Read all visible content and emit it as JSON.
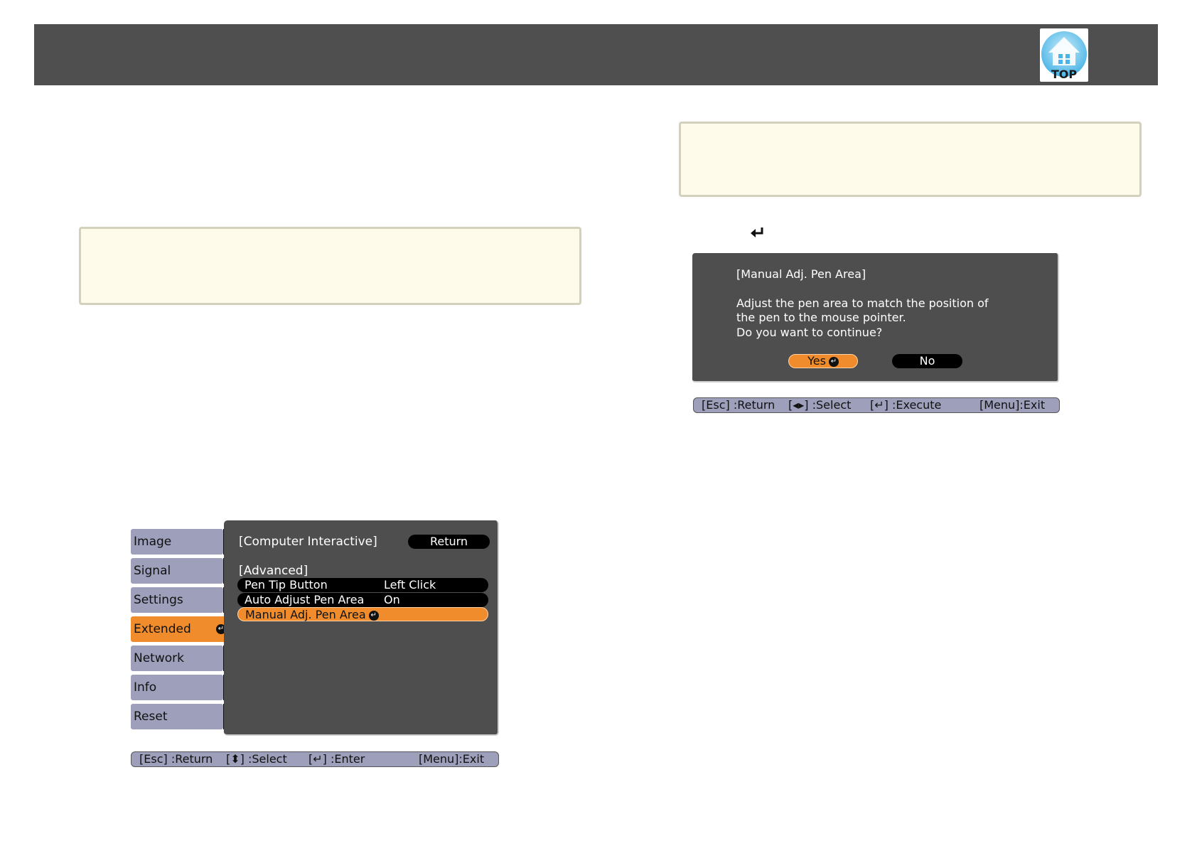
{
  "header": {
    "top_button_label": "TOP"
  },
  "colors": {
    "header_bg": "#4f4f4f",
    "note_bg": "#fefbea",
    "note_border": "#d3d0bc",
    "menu_bg": "#4e4e4e",
    "tab_bg": "#9d9fbb",
    "accent": "#f08c2b"
  },
  "config_menu": {
    "tabs": [
      {
        "label": "Image"
      },
      {
        "label": "Signal"
      },
      {
        "label": "Settings"
      },
      {
        "label": "Extended",
        "active": true
      },
      {
        "label": "Network"
      },
      {
        "label": "Info"
      },
      {
        "label": "Reset"
      }
    ],
    "panel_title": "[Computer Interactive]",
    "return_label": "Return",
    "section_title": "[Advanced]",
    "rows": [
      {
        "label": "Pen Tip Button",
        "value": "Left Click"
      },
      {
        "label": "Auto Adjust Pen Area",
        "value": "On"
      },
      {
        "label": "Manual Adj. Pen Area",
        "value": ""
      }
    ],
    "hints": {
      "esc": "[Esc] :Return",
      "select": "[⬍] :Select",
      "enter": "[↵] :Enter",
      "menu": "[Menu]:Exit"
    }
  },
  "dialog": {
    "title": "[Manual Adj. Pen Area]",
    "line1": "Adjust the pen area to match the position of",
    "line2": "the pen to the mouse pointer.",
    "line3": "Do you want to continue?",
    "yes_label": "Yes",
    "no_label": "No",
    "hints": {
      "esc": "[Esc] :Return",
      "select": "[◂▸] :Select",
      "execute": "[↵] :Execute",
      "menu": "[Menu]:Exit"
    }
  }
}
